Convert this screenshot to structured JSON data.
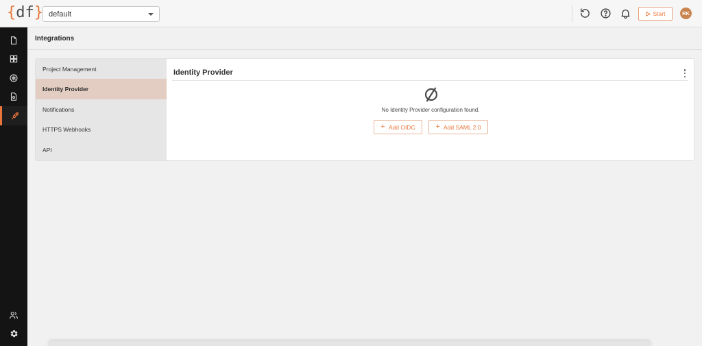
{
  "topbar": {
    "logo_left": "{",
    "logo_text": "df",
    "logo_right": "}",
    "namespace": "default",
    "start_label": "Start",
    "avatar_initials": "RK",
    "accent": "#e8763a"
  },
  "rail": {
    "items": [
      {
        "icon": "document-icon"
      },
      {
        "icon": "grid-icon"
      },
      {
        "icon": "atom-icon"
      },
      {
        "icon": "files-icon"
      },
      {
        "icon": "plug-icon",
        "active": true
      }
    ],
    "bottom": [
      {
        "icon": "users-icon"
      },
      {
        "icon": "gear-icon"
      }
    ]
  },
  "page": {
    "title": "Integrations"
  },
  "nav": {
    "items": [
      {
        "label": "Project Management"
      },
      {
        "label": "Identity Provider",
        "active": true
      },
      {
        "label": "Notifications"
      },
      {
        "label": "HTTPS Webhooks"
      },
      {
        "label": "API"
      }
    ]
  },
  "panel": {
    "title": "Identity Provider",
    "empty_icon": "empty-set-icon",
    "empty_text": "No Identity Provider configuration found.",
    "add_oidc": "Add OIDC",
    "add_saml": "Add SAML 2.0"
  }
}
